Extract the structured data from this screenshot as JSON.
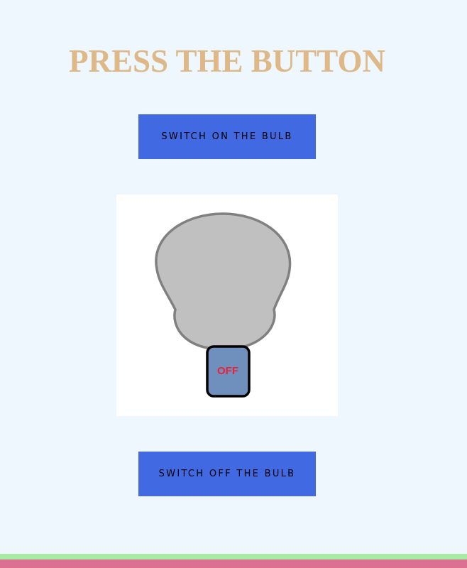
{
  "page": {
    "title": "PRESS THE BUTTON"
  },
  "buttons": {
    "switch_on_label": "SWITCH ON THE BULB",
    "switch_off_label": "SWITCH OFF THE BULB"
  },
  "bulb": {
    "state": "off",
    "switch_label": "OFF",
    "colors": {
      "glass": "#c0c0c0",
      "glass_outline": "#808080",
      "switch_fill": "#6f8fbd",
      "switch_text": "#e8213b"
    }
  },
  "theme": {
    "background": "#eef7fe",
    "title_color": "#deb887",
    "button_color": "#4169e1",
    "footer_top": "#a7eba6",
    "footer_bottom": "#db7093"
  }
}
